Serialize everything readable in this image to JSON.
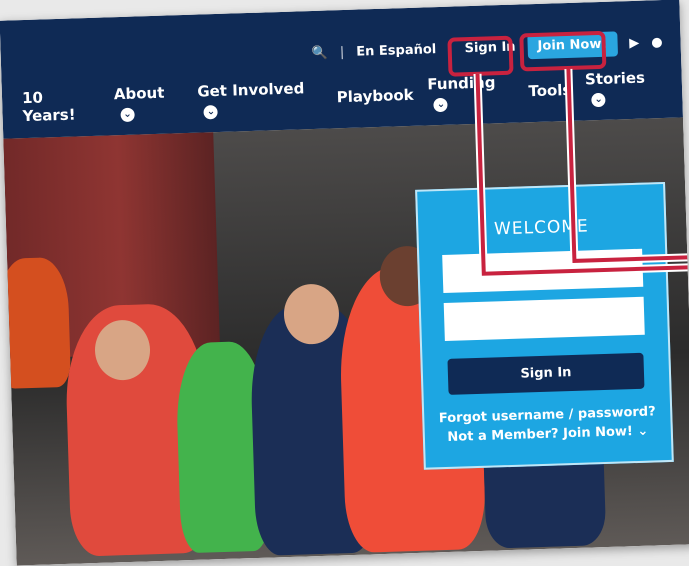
{
  "utility_nav": {
    "espanol": "En Español",
    "sign_in": "Sign In",
    "join_now": "Join Now!"
  },
  "main_nav": [
    "10 Years!",
    "About",
    "Get Involved",
    "Playbook",
    "Funding",
    "Tools",
    "Stories"
  ],
  "login_panel": {
    "title": "WELCOME",
    "button": "Sign In",
    "forgot_link": "Forgot username / password?",
    "member_link": "Not a Member? Join Now!"
  },
  "icons": [
    "search-icon",
    "play-store-icon",
    "apple-icon",
    "chevron-down-icon"
  ],
  "colors": {
    "navy": "#0f2a55",
    "accent_blue": "#2aa6e0",
    "highlight": "#c8223f"
  }
}
